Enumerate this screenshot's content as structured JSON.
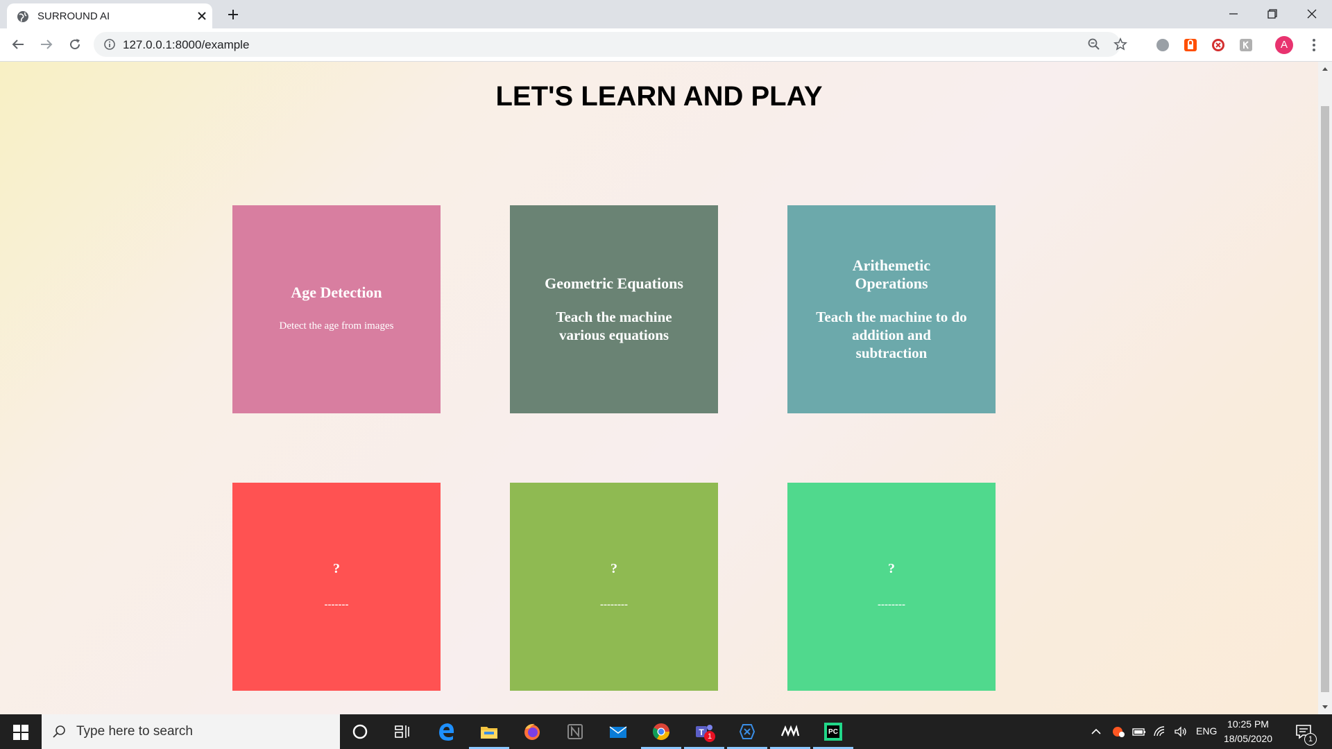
{
  "browser": {
    "tab": {
      "title": "SURROUND AI"
    },
    "address": {
      "url": "127.0.0.1:8000/example"
    },
    "profile": {
      "initial": "A"
    }
  },
  "page": {
    "heading": "LET'S LEARN AND PLAY",
    "cards": [
      {
        "title": "Age Detection",
        "desc": "Detect the age from images",
        "color": "#d87ea0"
      },
      {
        "title": "Geometric Equations",
        "desc": "Teach the machine various equations",
        "color": "#6a8374"
      },
      {
        "title": "Arithemetic Operations",
        "desc": "Teach the machine to do addition and subtraction",
        "color": "#6ca9ab"
      },
      {
        "title": "?",
        "desc": "-------",
        "color": "#ff5252"
      },
      {
        "title": "?",
        "desc": "--------",
        "color": "#8fba52"
      },
      {
        "title": "?",
        "desc": "--------",
        "color": "#50d98d"
      }
    ]
  },
  "taskbar": {
    "search_placeholder": "Type here to search",
    "language": "ENG",
    "time": "10:25 PM",
    "date": "18/05/2020",
    "teams_badge": "1",
    "notification_count": "1",
    "apps": [
      "cortana-icon",
      "task-view-icon",
      "edge-icon",
      "file-explorer-icon",
      "firefox-icon",
      "notion-icon",
      "mail-icon",
      "chrome-icon",
      "teams-icon",
      "visual-studio-icon",
      "mw-app-icon",
      "pycharm-icon"
    ]
  }
}
